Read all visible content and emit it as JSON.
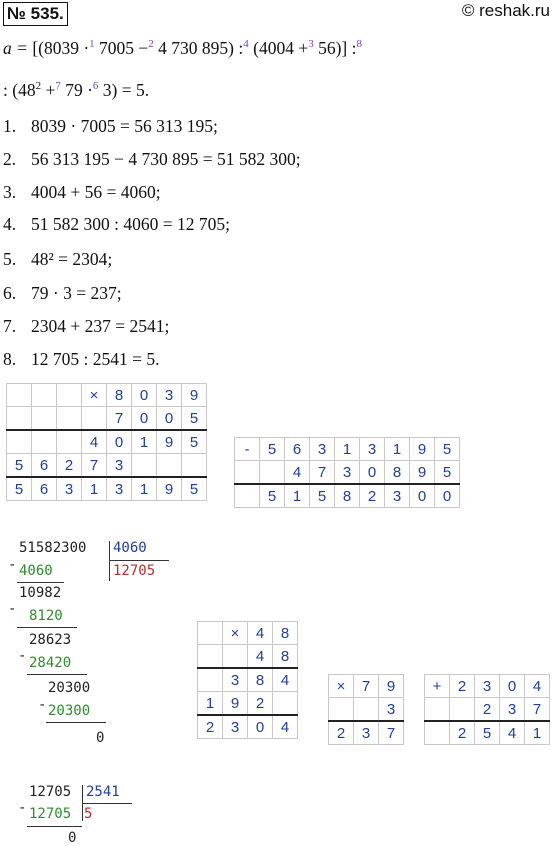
{
  "header": {
    "problem_number": "№ 535.",
    "site": "© reshak.ru"
  },
  "expression": {
    "line1_a": "a = ",
    "line1_b": "[(8039 ·",
    "o1": "1",
    "line1_c": " 7005 −",
    "o2": "2",
    "line1_d": " 4 730 895) :",
    "o4": "4",
    "line1_e": " (4004 +",
    "o3": "3",
    "line1_f": " 56)] :",
    "o8": "8",
    "line2_a": ": (48",
    "sq": "2",
    "line2_b": " +",
    "o7": "7",
    "line2_c": " 79 ·",
    "o6": "6",
    "line2_d": " 3) = 5."
  },
  "steps": [
    {
      "n": "1.",
      "text": "8039 · 7005 = 56 313 195;"
    },
    {
      "n": "2.",
      "text": "56 313 195 − 4 730 895 = 51 582 300;"
    },
    {
      "n": "3.",
      "text": "4004 + 56 = 4060;"
    },
    {
      "n": "4.",
      "text": "51 582 300 : 4060 = 12 705;"
    },
    {
      "n": "5.",
      "text": "48² = 2304;"
    },
    {
      "n": "6.",
      "text": "79 · 3 = 237;"
    },
    {
      "n": "7.",
      "text": "2304 + 237 = 2541;"
    },
    {
      "n": "8.",
      "text": "12 705 : 2541 = 5."
    }
  ],
  "mult1": [
    [
      "",
      "",
      "",
      "×",
      "8",
      "0",
      "3",
      "9"
    ],
    [
      "",
      "",
      "",
      "",
      "7",
      "0",
      "0",
      "5"
    ],
    [
      "",
      "",
      "",
      "4",
      "0",
      "1",
      "9",
      "5"
    ],
    [
      "5",
      "6",
      "2",
      "7",
      "3",
      "",
      "",
      ""
    ],
    [
      "5",
      "6",
      "3",
      "1",
      "3",
      "1",
      "9",
      "5"
    ]
  ],
  "sub1": [
    [
      "-",
      "5",
      "6",
      "3",
      "1",
      "3",
      "1",
      "9",
      "5"
    ],
    [
      "",
      "",
      "4",
      "7",
      "3",
      "0",
      "8",
      "9",
      "5"
    ],
    [
      "",
      "5",
      "1",
      "5",
      "8",
      "2",
      "3",
      "0",
      "0"
    ]
  ],
  "division1": {
    "dividend": "51582300",
    "divisor": "4060",
    "quotient": "12705",
    "s1": "4060",
    "r1": "10982",
    "s2": "8120",
    "r2": "28623",
    "s3": "28420",
    "r3": "20300",
    "s4": "20300",
    "r4": "0"
  },
  "mult2": [
    [
      "",
      "×",
      "4",
      "8"
    ],
    [
      "",
      "",
      "4",
      "8"
    ],
    [
      "",
      "3",
      "8",
      "4"
    ],
    [
      "1",
      "9",
      "2",
      ""
    ],
    [
      "2",
      "3",
      "0",
      "4"
    ]
  ],
  "mult3": [
    [
      "×",
      "7",
      "9"
    ],
    [
      "",
      "",
      "3"
    ],
    [
      "2",
      "3",
      "7"
    ]
  ],
  "add1": [
    [
      "+",
      "2",
      "3",
      "0",
      "4"
    ],
    [
      "",
      "",
      "2",
      "3",
      "7"
    ],
    [
      "",
      "2",
      "5",
      "4",
      "1"
    ]
  ],
  "division2": {
    "dividend": "12705",
    "divisor": "2541",
    "quotient": "5",
    "s1": "12705",
    "r1": "0"
  },
  "minus": "-"
}
